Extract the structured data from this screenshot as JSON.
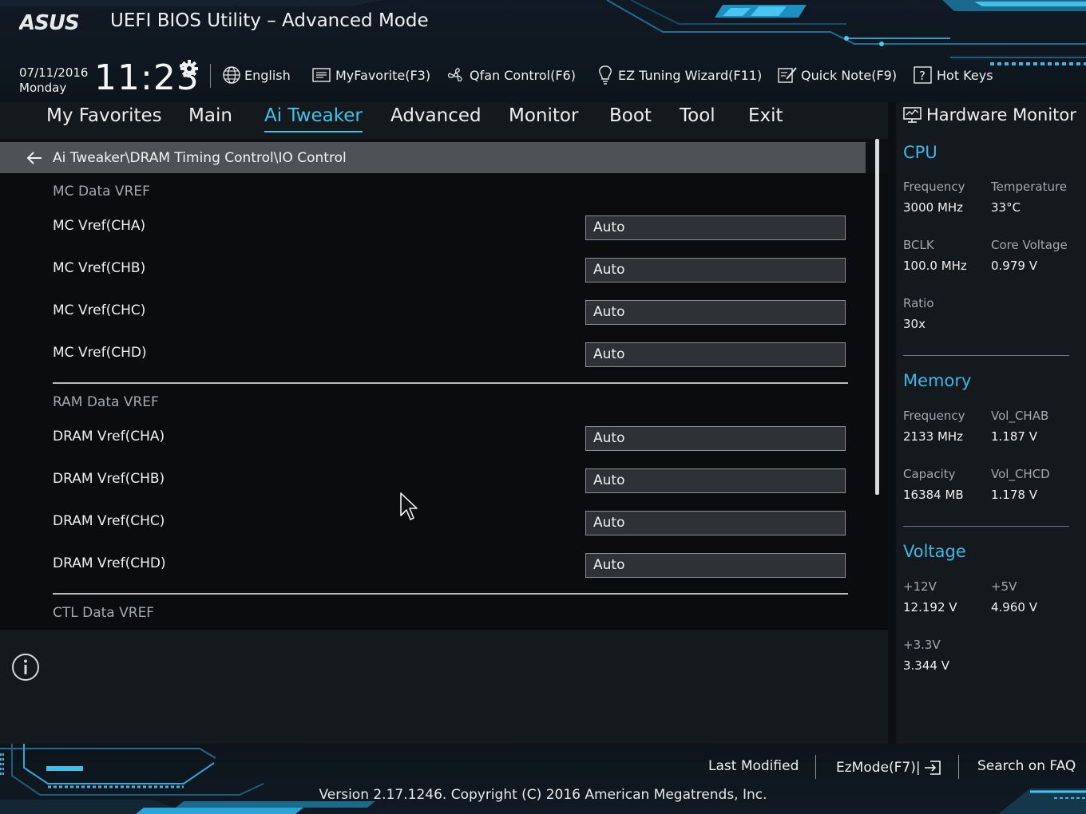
{
  "header": {
    "brand": "ASUS",
    "title": "UEFI BIOS Utility – Advanced Mode",
    "date": "07/11/2016",
    "day": "Monday",
    "time": "11:23",
    "toolbar": [
      {
        "label": "English",
        "icon": "globe-icon"
      },
      {
        "label": "MyFavorite(F3)",
        "icon": "favorite-list-icon"
      },
      {
        "label": "Qfan Control(F6)",
        "icon": "fan-icon"
      },
      {
        "label": "EZ Tuning Wizard(F11)",
        "icon": "lightbulb-icon"
      },
      {
        "label": "Quick Note(F9)",
        "icon": "note-icon"
      },
      {
        "label": "Hot Keys",
        "icon": "question-icon"
      }
    ]
  },
  "tabs": [
    {
      "label": "My Favorites",
      "active": false
    },
    {
      "label": "Main",
      "active": false
    },
    {
      "label": "Ai Tweaker",
      "active": true
    },
    {
      "label": "Advanced",
      "active": false
    },
    {
      "label": "Monitor",
      "active": false
    },
    {
      "label": "Boot",
      "active": false
    },
    {
      "label": "Tool",
      "active": false
    },
    {
      "label": "Exit",
      "active": false
    }
  ],
  "breadcrumb": "Ai Tweaker\\DRAM Timing Control\\IO Control",
  "sections": [
    {
      "title": "MC Data VREF",
      "items": [
        {
          "label": "MC Vref(CHA)",
          "value": "Auto"
        },
        {
          "label": "MC Vref(CHB)",
          "value": "Auto"
        },
        {
          "label": "MC Vref(CHC)",
          "value": "Auto"
        },
        {
          "label": "MC Vref(CHD)",
          "value": "Auto"
        }
      ]
    },
    {
      "title": "RAM Data VREF",
      "items": [
        {
          "label": "DRAM Vref(CHA)",
          "value": "Auto"
        },
        {
          "label": "DRAM Vref(CHB)",
          "value": "Auto"
        },
        {
          "label": "DRAM Vref(CHC)",
          "value": "Auto"
        },
        {
          "label": "DRAM Vref(CHD)",
          "value": "Auto"
        }
      ]
    },
    {
      "title": "CTL Data VREF",
      "items": []
    }
  ],
  "hardware_monitor": {
    "title": "Hardware Monitor",
    "cpu": {
      "title": "CPU",
      "frequency_label": "Frequency",
      "frequency": "3000 MHz",
      "temperature_label": "Temperature",
      "temperature": "33°C",
      "bclk_label": "BCLK",
      "bclk": "100.0 MHz",
      "core_voltage_label": "Core Voltage",
      "core_voltage": "0.979 V",
      "ratio_label": "Ratio",
      "ratio": "30x"
    },
    "memory": {
      "title": "Memory",
      "frequency_label": "Frequency",
      "frequency": "2133 MHz",
      "vol_chab_label": "Vol_CHAB",
      "vol_chab": "1.187 V",
      "capacity_label": "Capacity",
      "capacity": "16384 MB",
      "vol_chcd_label": "Vol_CHCD",
      "vol_chcd": "1.178 V"
    },
    "voltage": {
      "title": "Voltage",
      "v12_label": "+12V",
      "v12": "12.192 V",
      "v5_label": "+5V",
      "v5": "4.960 V",
      "v33_label": "+3.3V",
      "v33": "3.344 V"
    }
  },
  "footer": {
    "last_modified": "Last Modified",
    "ezmode": "EzMode(F7)|",
    "search_faq": "Search on FAQ",
    "copyright": "Version 2.17.1246. Copyright (C) 2016 American Megatrends, Inc."
  },
  "colors": {
    "accent": "#3fc3ea",
    "section_title": "#3fb6e6",
    "breadcrumb_bg": "#4e5256",
    "option_box_bg": "#2e3236"
  }
}
